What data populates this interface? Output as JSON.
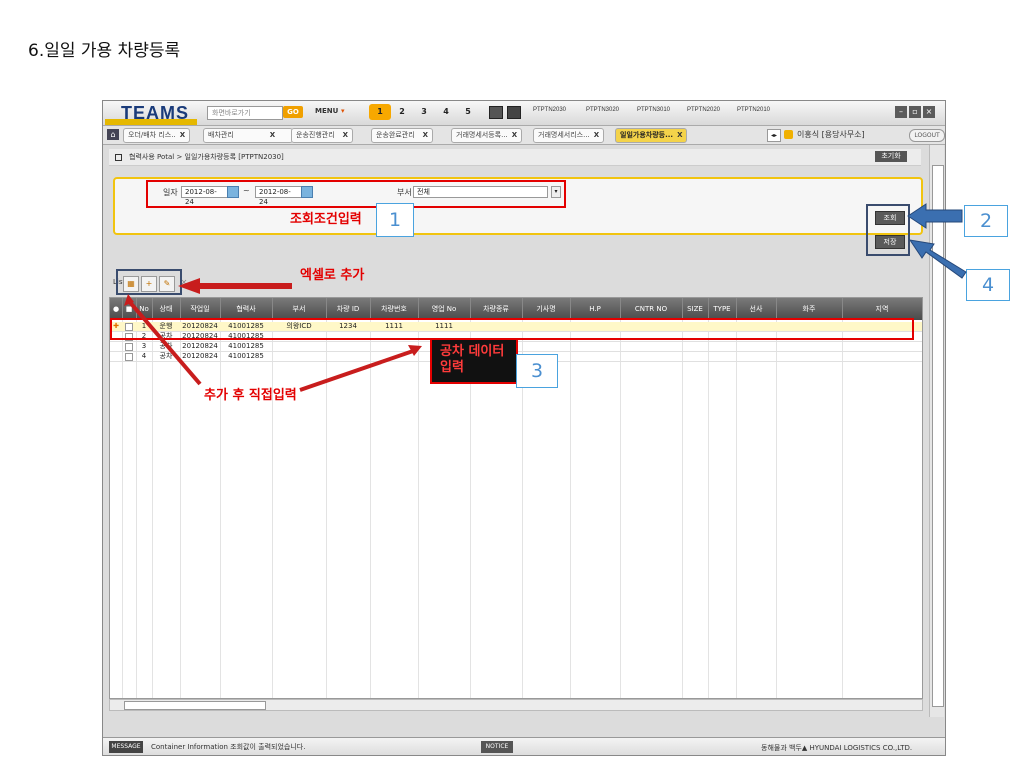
{
  "heading": "6.일일 가용 차량등록",
  "app": {
    "logo": "TEAMS",
    "search_placeholder": "화면바로가기",
    "go_label": "GO",
    "menu_label": "MENU",
    "pages": [
      "1",
      "2",
      "3",
      "4",
      "5"
    ],
    "quick_screens": [
      "PTPTN2030",
      "PTPTN3020",
      "PTPTN3010",
      "PTPTN2020",
      "PTPTN2010"
    ],
    "tabs": [
      {
        "label": "오더/배차 리스..",
        "active": false
      },
      {
        "label": "배차관리",
        "active": false
      },
      {
        "label": "운송진행관리",
        "active": false
      },
      {
        "label": "운송완료관리",
        "active": false
      },
      {
        "label": "거래명세서등록...",
        "active": false
      },
      {
        "label": "거래명세서리스...",
        "active": false
      },
      {
        "label": "일일가용차량등...",
        "active": true
      }
    ],
    "tab_close": "X",
    "user": "이홍식 [용당사무소]",
    "logout_label": "LOGOUT"
  },
  "breadcrumb": "협력사용 Potal > 일일가용차량등록 [PTPTN2030]",
  "reset_label": "초기화",
  "filter": {
    "date_label": "일자",
    "date_from": "2012-08-24",
    "date_sep": "~",
    "date_to": "2012-08-24",
    "dept_label": "부서",
    "dept_value": "전체"
  },
  "search_label": "조회",
  "save_label": "저장",
  "list_count": "List : 총 [0건]",
  "grid": {
    "columns": [
      "",
      "",
      "No",
      "상태",
      "작업일",
      "협력사",
      "부서",
      "차량 ID",
      "차량번호",
      "영업 No",
      "차량종류",
      "기사명",
      "H.P",
      "CNTR NO",
      "SIZE",
      "TYPE",
      "선사",
      "화주",
      "지역"
    ],
    "rows": [
      {
        "marker": "✚",
        "no": "1",
        "status": "운행",
        "date": "20120824",
        "partner": "41001285",
        "dept": "의왕ICD",
        "vid": "1234",
        "vno": "1111",
        "sales": "1111",
        "selected": true
      },
      {
        "marker": "",
        "no": "2",
        "status": "공차",
        "date": "20120824",
        "partner": "41001285",
        "dept": "",
        "vid": "",
        "vno": "",
        "sales": "",
        "selected": false
      },
      {
        "marker": "",
        "no": "3",
        "status": "공차",
        "date": "20120824",
        "partner": "41001285",
        "dept": "",
        "vid": "",
        "vno": "",
        "sales": "",
        "selected": false
      },
      {
        "marker": "",
        "no": "4",
        "status": "공차",
        "date": "20120824",
        "partner": "41001285",
        "dept": "",
        "vid": "",
        "vno": "",
        "sales": "",
        "selected": false
      }
    ]
  },
  "status": {
    "message_tag": "MESSAGE",
    "message": "Container Information 조회값이 출력되었습니다.",
    "notice_tag": "NOTICE",
    "brand": "동해물과 백두▲ HYUNDAI LOGISTICS CO.,LTD."
  },
  "annotations": {
    "filter_input": "조회조건입력",
    "excel_add": "엑셀로 추가",
    "direct_input": "추가 후 직접입력",
    "empty_data": "공차 데이터 입력",
    "n1": "1",
    "n2": "2",
    "n3": "3",
    "n4": "4"
  },
  "colors": {
    "annotation_red": "#e30000",
    "annotation_navy": "#3a4c6e",
    "highlight_yellow": "#f7a800",
    "callout_blue": "#4aa3df"
  }
}
